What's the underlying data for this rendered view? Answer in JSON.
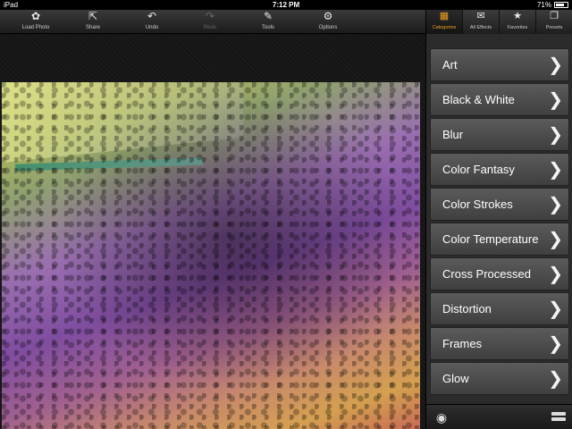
{
  "status_bar": {
    "device": "iPad",
    "time": "7:12 PM",
    "battery": "71%",
    "battery_level": 0.71
  },
  "toolbar": {
    "items": [
      {
        "label": "Load Photo",
        "icon": "gear-import-icon",
        "glyph": "✿",
        "enabled": true
      },
      {
        "label": "Share",
        "icon": "share-icon",
        "glyph": "⇱",
        "enabled": true
      },
      {
        "label": "Undo",
        "icon": "undo-icon",
        "glyph": "↶",
        "enabled": true
      },
      {
        "label": "Redo",
        "icon": "redo-icon",
        "glyph": "↷",
        "enabled": false
      },
      {
        "label": "Tools",
        "icon": "tools-icon",
        "glyph": "✎",
        "enabled": true
      },
      {
        "label": "Options",
        "icon": "gears-icon",
        "glyph": "⚙",
        "enabled": true
      }
    ]
  },
  "panel": {
    "tabs": [
      {
        "label": "Categories",
        "icon": "categories-icon",
        "glyph": "▦",
        "active": true
      },
      {
        "label": "All Effects",
        "icon": "inbox-icon",
        "glyph": "✉",
        "active": false
      },
      {
        "label": "Favorites",
        "icon": "star-icon",
        "glyph": "★",
        "active": false
      },
      {
        "label": "Presets",
        "icon": "folder-icon",
        "glyph": "❐",
        "active": false
      }
    ],
    "categories": [
      "Art",
      "Black & White",
      "Blur",
      "Color Fantasy",
      "Color Strokes",
      "Color Temperature",
      "Cross Processed",
      "Distortion",
      "Frames",
      "Glow"
    ],
    "chevron_glyph": "❯",
    "footer": {
      "eye_glyph": "◉"
    }
  }
}
